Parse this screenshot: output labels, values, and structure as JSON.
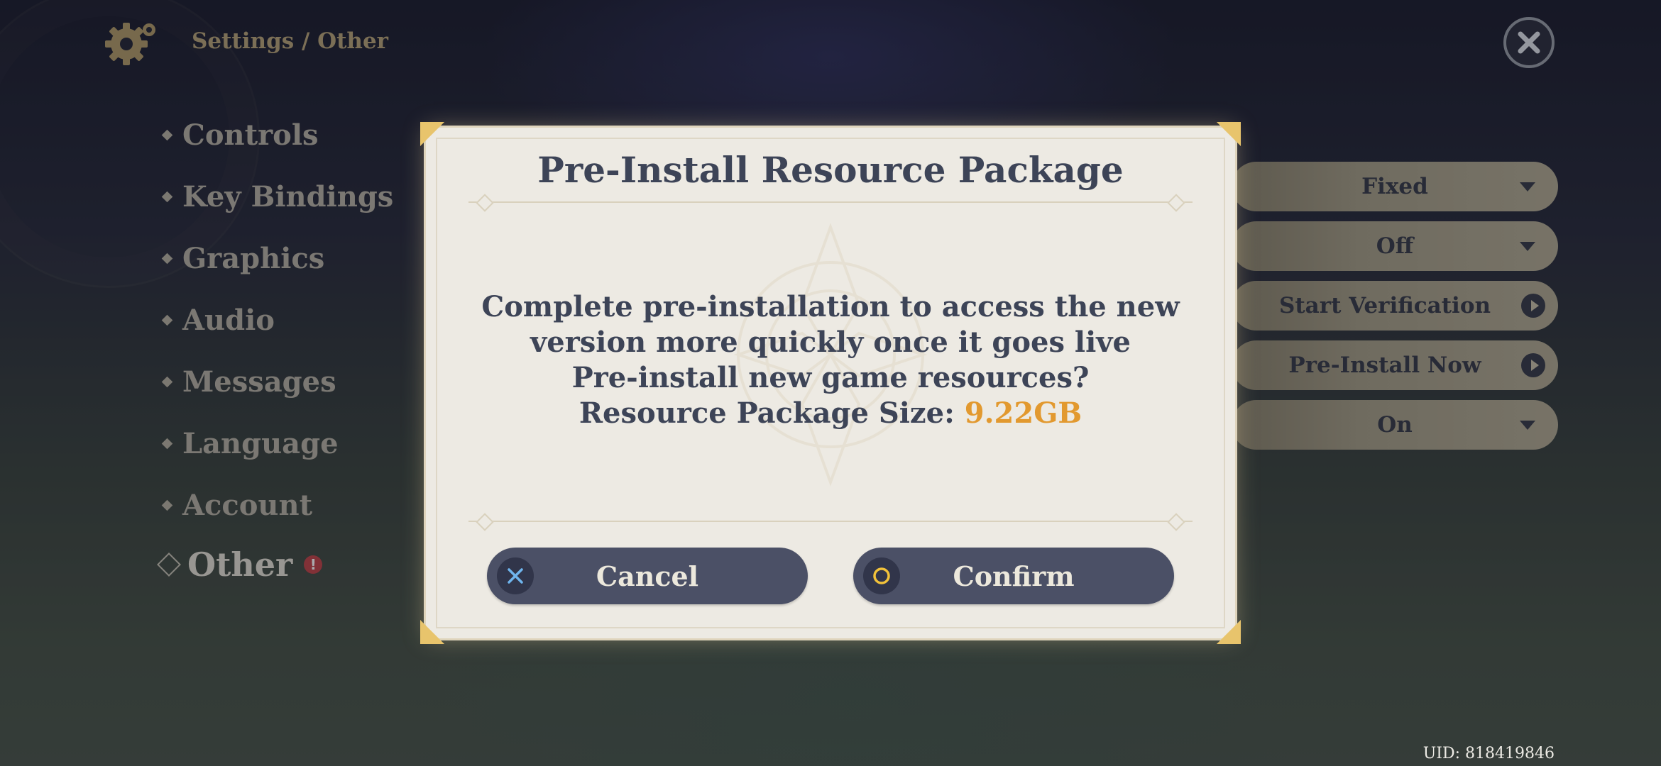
{
  "header": {
    "breadcrumb": "Settings / Other"
  },
  "sidebar": {
    "items": [
      {
        "label": "Controls"
      },
      {
        "label": "Key Bindings"
      },
      {
        "label": "Graphics"
      },
      {
        "label": "Audio"
      },
      {
        "label": "Messages"
      },
      {
        "label": "Language"
      },
      {
        "label": "Account"
      },
      {
        "label": "Other",
        "active": true,
        "badge": "!"
      }
    ]
  },
  "options": [
    {
      "value": "Fixed",
      "control": "dropdown"
    },
    {
      "value": "Off",
      "control": "dropdown"
    },
    {
      "value": "Start Verification",
      "control": "action"
    },
    {
      "value": "Pre-Install Now",
      "control": "action"
    },
    {
      "value": "On",
      "control": "dropdown"
    }
  ],
  "dialog": {
    "title": "Pre-Install Resource Package",
    "line1": "Complete pre-installation to access the new",
    "line2": "version more quickly once it goes live",
    "line3": "Pre-install new game resources?",
    "size_label": "Resource Package Size:",
    "size_value": "9.22GB",
    "cancel_label": "Cancel",
    "confirm_label": "Confirm"
  },
  "footer": {
    "uid": "UID: 818419846"
  },
  "colors": {
    "accent_gold": "#e2992f",
    "button_bg": "#4b5066",
    "dialog_bg": "#edeae3",
    "text_dark": "#3d4457",
    "badge_red": "#c2454a"
  }
}
